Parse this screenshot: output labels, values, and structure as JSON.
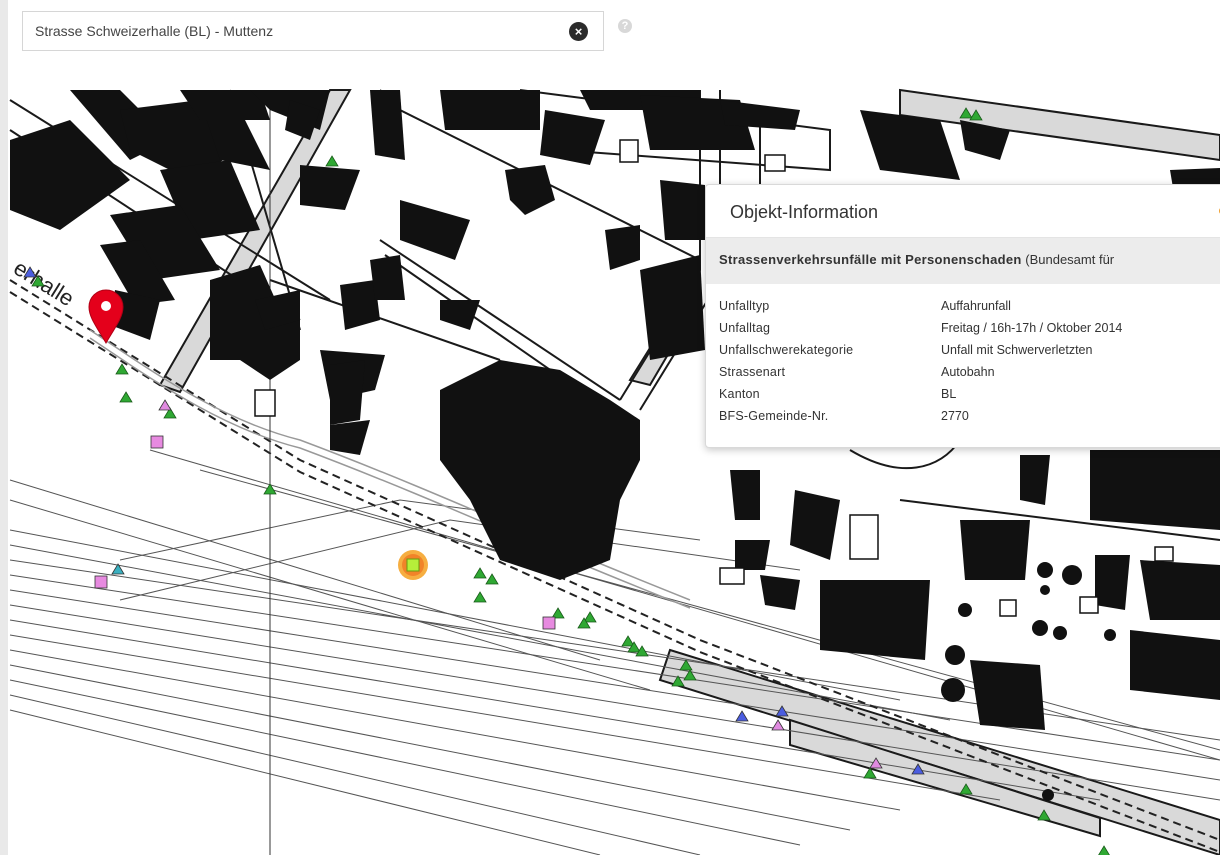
{
  "search": {
    "value": "Strasse Schweizerhalle (BL) - Muttenz",
    "clear_icon": "close-circle-icon",
    "help_icon": "question-circle-icon"
  },
  "map": {
    "street_label": "erhalle",
    "accident_marker_color": "#2fa833",
    "selected_marker_color": "#f5a020",
    "pin_color": "#e4001b"
  },
  "popup": {
    "title": "Objekt-Information",
    "layer_name_bold": "Strassenverkehrsunfälle mit Personenschaden",
    "layer_source": "(Bundesamt für",
    "rows": [
      {
        "label": "Unfalltyp",
        "value": "Auffahrunfall"
      },
      {
        "label": "Unfalltag",
        "value": "Freitag / 16h-17h / Oktober 2014"
      },
      {
        "label": "Unfallschwerekategorie",
        "value": "Unfall mit Schwerverletzten"
      },
      {
        "label": "Strassenart",
        "value": "Autobahn"
      },
      {
        "label": "Kanton",
        "value": "BL"
      },
      {
        "label": "BFS-Gemeinde-Nr.",
        "value": "2770"
      }
    ]
  }
}
